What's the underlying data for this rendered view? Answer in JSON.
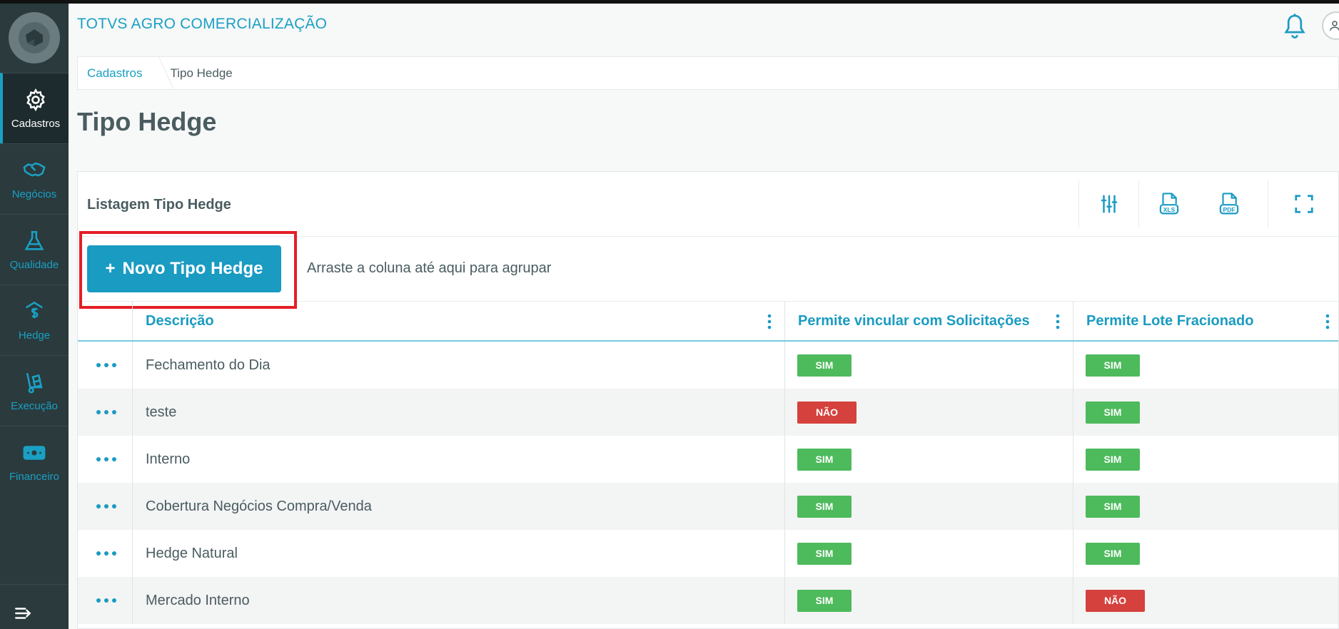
{
  "app": {
    "title": "TOTVS AGRO COMERCIALIZAÇÃO"
  },
  "sidebar": {
    "items": [
      {
        "label": "Cadastros",
        "icon": "gear-icon",
        "active": true
      },
      {
        "label": "Negócios",
        "icon": "handshake-icon"
      },
      {
        "label": "Qualidade",
        "icon": "flask-icon"
      },
      {
        "label": "Hedge",
        "icon": "hedge-dollar-icon"
      },
      {
        "label": "Execução",
        "icon": "hand-truck-icon"
      },
      {
        "label": "Financeiro",
        "icon": "money-bill-icon"
      }
    ]
  },
  "breadcrumb": {
    "parent": "Cadastros",
    "current": "Tipo Hedge"
  },
  "page": {
    "title": "Tipo Hedge"
  },
  "panel": {
    "title": "Listagem Tipo Hedge",
    "new_button_plus": "+",
    "new_button_label": "Novo Tipo Hedge",
    "group_hint": "Arraste a coluna até aqui para agrupar"
  },
  "table": {
    "columns": [
      "Descrição",
      "Permite vincular com Solicitações",
      "Permite Lote Fracionado"
    ],
    "rows": [
      {
        "descricao": "Fechamento do Dia",
        "solicitacoes": "SIM",
        "lote": "SIM"
      },
      {
        "descricao": "teste",
        "solicitacoes": "NÃO",
        "lote": "SIM"
      },
      {
        "descricao": "Interno",
        "solicitacoes": "SIM",
        "lote": "SIM"
      },
      {
        "descricao": "Cobertura Negócios Compra/Venda",
        "solicitacoes": "SIM",
        "lote": "SIM"
      },
      {
        "descricao": "Hedge Natural",
        "solicitacoes": "SIM",
        "lote": "SIM"
      },
      {
        "descricao": "Mercado Interno",
        "solicitacoes": "SIM",
        "lote": "NÃO"
      }
    ]
  },
  "colors": {
    "accent": "#1a9bc2",
    "sidebar": "#2a3a3d",
    "yes": "#4dba5c",
    "no": "#d5413d",
    "highlight": "#e41e26"
  }
}
